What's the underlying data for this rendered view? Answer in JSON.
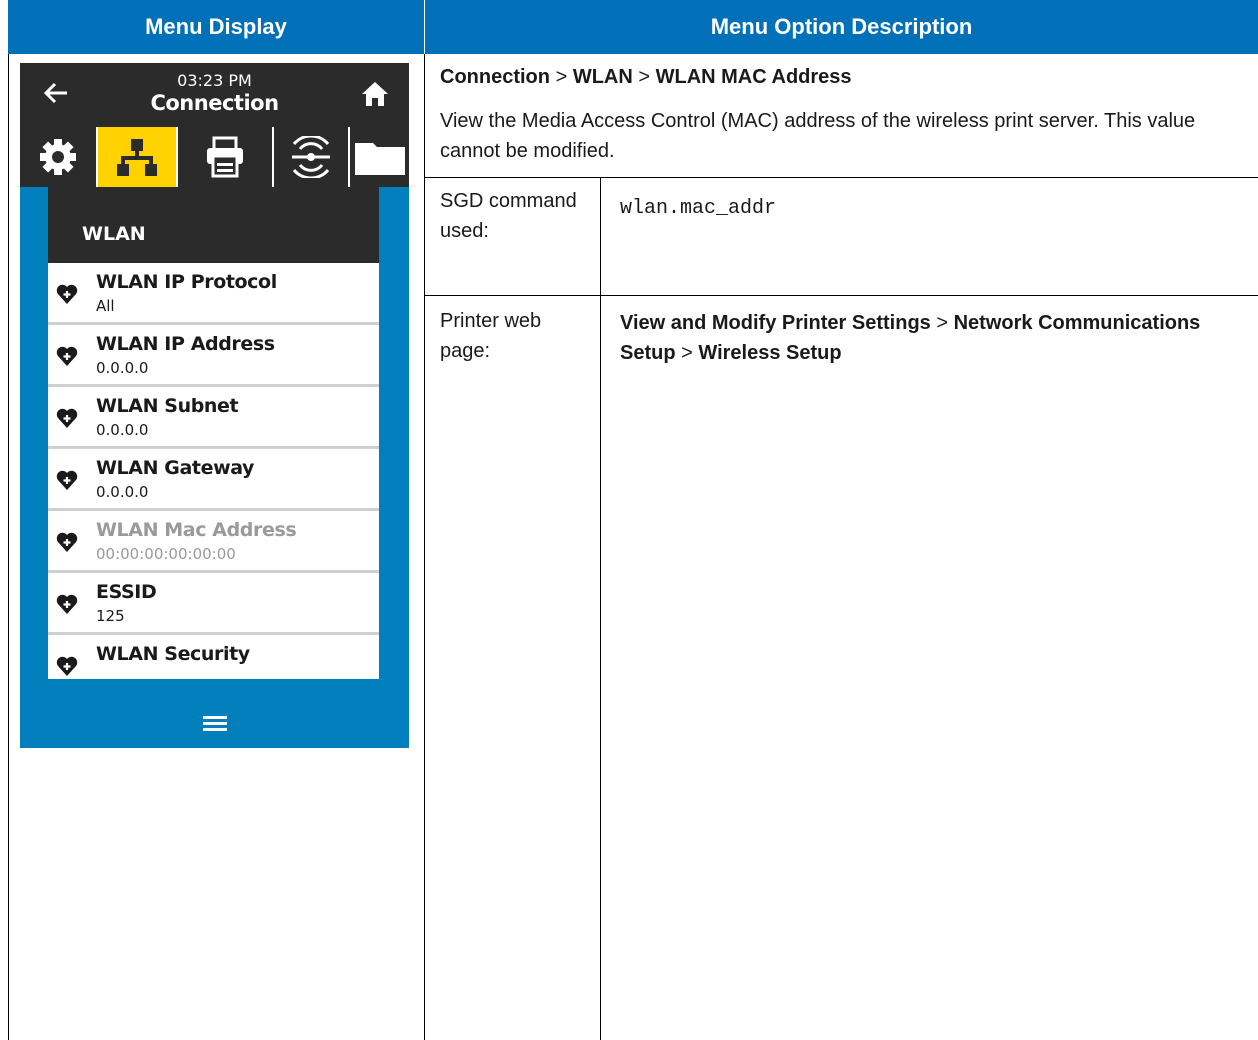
{
  "headers": {
    "left": "Menu Display",
    "right": "Menu Option Description"
  },
  "device": {
    "time": "03:23 PM",
    "title": "Connection",
    "tabs": [
      "settings",
      "connection",
      "print",
      "radio",
      "storage"
    ],
    "selected_tab": "connection",
    "list_header": "WLAN",
    "items": [
      {
        "name": "WLAN IP Protocol",
        "value": "All"
      },
      {
        "name": "WLAN IP Address",
        "value": "0.0.0.0"
      },
      {
        "name": "WLAN Subnet",
        "value": "0.0.0.0"
      },
      {
        "name": "WLAN Gateway",
        "value": "0.0.0.0"
      },
      {
        "name": "WLAN Mac Address",
        "value": "00:00:00:00:00:00"
      },
      {
        "name": "ESSID",
        "value": "125"
      },
      {
        "name": "WLAN Security",
        "value": ""
      }
    ],
    "colors": {
      "accent": "#007fbc",
      "selected": "#ffd200",
      "bar": "#2b2b2b"
    }
  },
  "description": {
    "crumb": [
      "Connection",
      "WLAN",
      "WLAN MAC Address"
    ],
    "crumb_sep": ">",
    "text": "View the Media Access Control (MAC) address of the wireless print server. This value cannot be modified.",
    "sgd_label": "SGD command used:",
    "sgd_value": "wlan.mac_addr",
    "web_label": "Printer web page:",
    "web_path": [
      "View and Modify Printer Settings",
      "Network Communications Setup",
      "Wireless Setup"
    ]
  },
  "header_color": "#0070b8"
}
